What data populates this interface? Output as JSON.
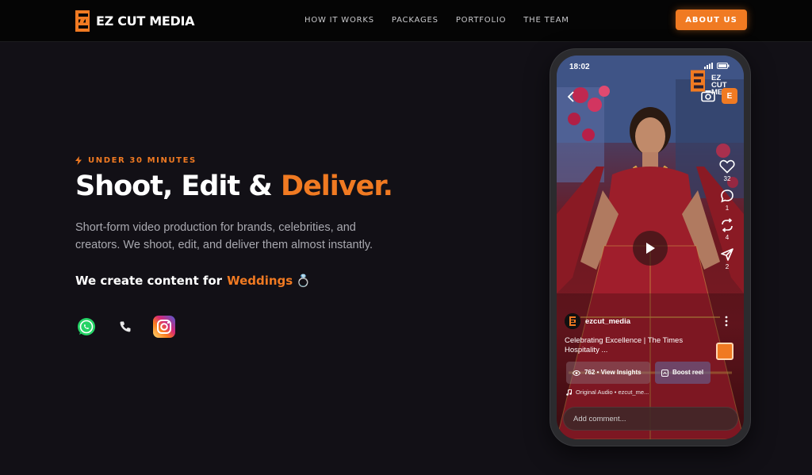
{
  "nav": {
    "brand": "EZ CUT MEDIA",
    "links": [
      "HOW IT WORKS",
      "PACKAGES",
      "PORTFOLIO",
      "THE TEAM"
    ],
    "cta": "ABOUT US"
  },
  "hero": {
    "kicker": "UNDER 30 MINUTES",
    "headline_main": "Shoot, Edit & ",
    "headline_accent": "Deliver.",
    "subtext": "Short-form video production for brands, celebrities, and creators. We shoot, edit, and deliver them almost instantly.",
    "create_prefix": "We create content for",
    "create_word": "Weddings",
    "create_emoji": "💍",
    "socials": [
      "whatsapp-icon",
      "phone-icon",
      "instagram-icon"
    ]
  },
  "phone": {
    "time": "18:02",
    "watermark": "EZ CUT\nMEDIA",
    "badge": "E",
    "likes": "32",
    "comments": "1",
    "reposts": "4",
    "shares": "2",
    "account": "ezcut_media",
    "caption": "Celebrating Excellence | The Times Hospitality ...",
    "insights_label": "762 • View Insights",
    "boost_label": "Boost reel",
    "audio": "Original Audio • ezcut_me...",
    "comment_placeholder": "Add comment..."
  },
  "colors": {
    "accent": "#f07a22",
    "background": "#121016",
    "nav_bg": "#050505"
  }
}
